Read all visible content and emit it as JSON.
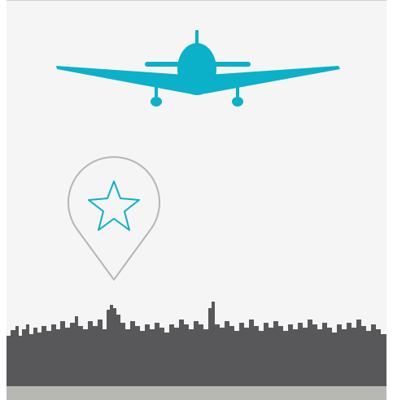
{
  "colors": {
    "background": "#f5f5f5",
    "plane": "#0bb0c9",
    "pin_outline": "#b5b5b5",
    "star": "#0bb0c9",
    "skyline": "#58585a",
    "ground": "#b7b8b4"
  },
  "icons": {
    "plane": "airplane-icon",
    "pin": "map-pin-icon",
    "star": "star-icon",
    "skyline": "city-skyline"
  }
}
